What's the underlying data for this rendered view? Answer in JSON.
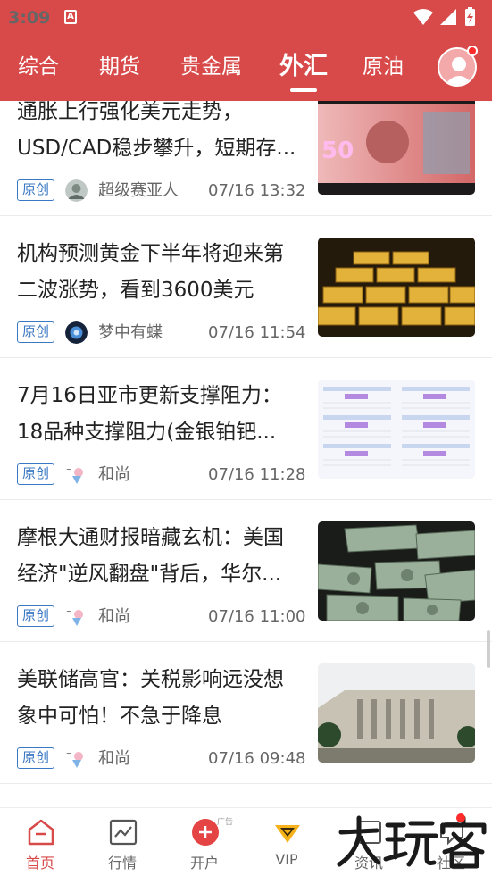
{
  "status_bar": {
    "time": "3:09",
    "notification_icon": "A"
  },
  "tabs": [
    {
      "label": "综合",
      "active": false
    },
    {
      "label": "期货",
      "active": false
    },
    {
      "label": "贵金属",
      "active": false
    },
    {
      "label": "外汇",
      "active": true
    },
    {
      "label": "原油",
      "active": false
    }
  ],
  "articles": [
    {
      "title": "通胀上行强化美元走势，USD/CAD稳步攀升，短期存...",
      "tag": "原创",
      "author": "超级赛亚人",
      "time": "07/16 13:32",
      "thumbnail": "canadian-50-banknote"
    },
    {
      "title": "机构预测黄金下半年将迎来第二波涨势，看到3600美元",
      "tag": "原创",
      "author": "梦中有蝶",
      "time": "07/16 11:54",
      "thumbnail": "gold-bars"
    },
    {
      "title": "7月16日亚市更新支撑阻力：18品种支撑阻力(金银铂钯...",
      "tag": "原创",
      "author": "和尚",
      "time": "07/16 11:28",
      "thumbnail": "support-resistance-table"
    },
    {
      "title": "摩根大通财报暗藏玄机：美国经济\"逆风翻盘\"背后，华尔...",
      "tag": "原创",
      "author": "和尚",
      "time": "07/16 11:00",
      "thumbnail": "us-dollar-bills"
    },
    {
      "title": "美联储高官：关税影响远没想象中可怕！不急于降息",
      "tag": "原创",
      "author": "和尚",
      "time": "07/16 09:48",
      "thumbnail": "federal-reserve-building"
    }
  ],
  "bottom_nav": [
    {
      "label": "首页",
      "icon": "home-icon",
      "active": true
    },
    {
      "label": "行情",
      "icon": "chart-icon",
      "active": false
    },
    {
      "label": "开户",
      "icon": "plus-circle-icon",
      "active": false,
      "ad_label": "广告"
    },
    {
      "label": "VIP",
      "icon": "vip-diamond-icon",
      "active": false
    },
    {
      "label": "资讯",
      "icon": "news-icon",
      "active": false
    },
    {
      "label": "社区",
      "icon": "community-icon",
      "active": false
    }
  ],
  "watermark": "大玩家",
  "colors": {
    "brand_red": "#d84a4a",
    "tag_blue": "#3b78c4",
    "text_gray": "#666666"
  }
}
